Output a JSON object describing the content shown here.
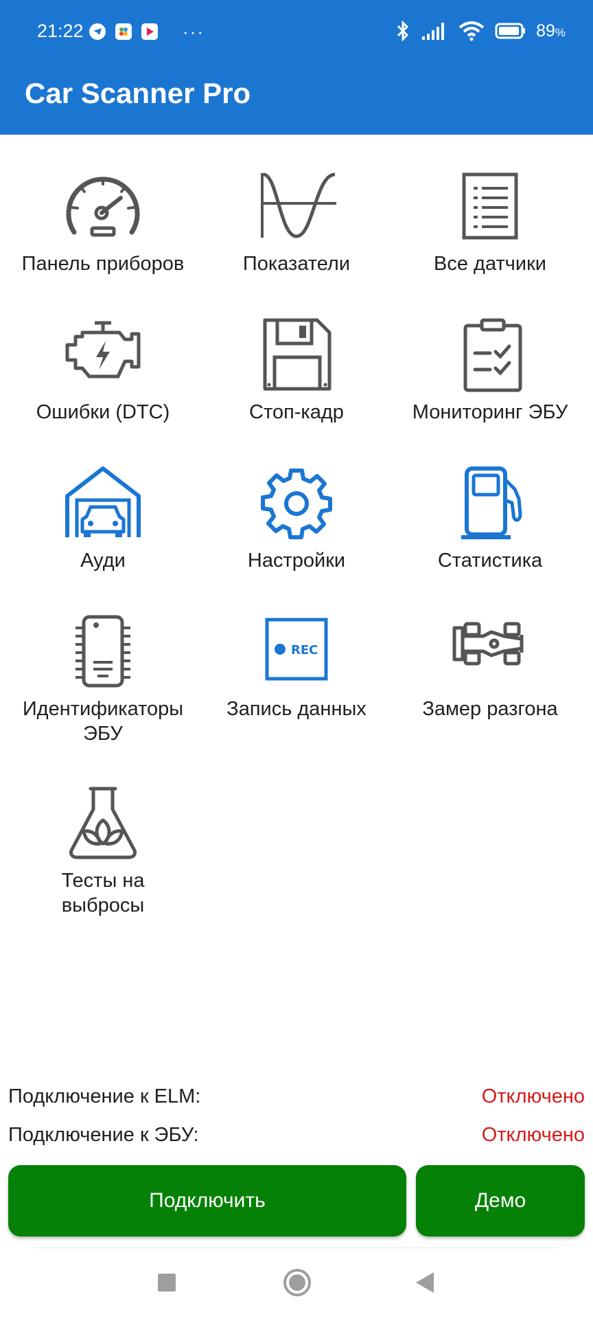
{
  "status_bar": {
    "time": "21:22",
    "more": "···",
    "battery": "89",
    "battery_unit": "%"
  },
  "app": {
    "title": "Car Scanner Pro"
  },
  "menu": [
    {
      "label": "Панель приборов",
      "icon": "gauge-icon"
    },
    {
      "label": "Показатели",
      "icon": "waveform-icon"
    },
    {
      "label": "Все датчики",
      "icon": "list-icon"
    },
    {
      "label": "Ошибки (DTC)",
      "icon": "engine-icon"
    },
    {
      "label": "Стоп-кадр",
      "icon": "floppy-icon"
    },
    {
      "label": "Мониторинг ЭБУ",
      "icon": "clipboard-check-icon"
    },
    {
      "label": "Ауди",
      "icon": "garage-car-icon"
    },
    {
      "label": "Настройки",
      "icon": "gear-icon"
    },
    {
      "label": "Статистика",
      "icon": "fuel-pump-icon"
    },
    {
      "label": "Идентификаторы ЭБУ",
      "icon": "chip-icon"
    },
    {
      "label": "Запись данных",
      "icon": "rec-icon",
      "badge": "REC"
    },
    {
      "label": "Замер разгона",
      "icon": "race-car-icon"
    },
    {
      "label": "Тесты на выбросы",
      "icon": "flask-leaf-icon"
    }
  ],
  "connection": {
    "elm_label": "Подключение к ELM:",
    "elm_status": "Отключено",
    "ecu_label": "Подключение к ЭБУ:",
    "ecu_status": "Отключено"
  },
  "buttons": {
    "connect": "Подключить",
    "demo": "Демо"
  },
  "colors": {
    "primary": "#1b76d2",
    "accent_green": "#068107",
    "error": "#d71a1a",
    "icon_gray": "#555555"
  }
}
